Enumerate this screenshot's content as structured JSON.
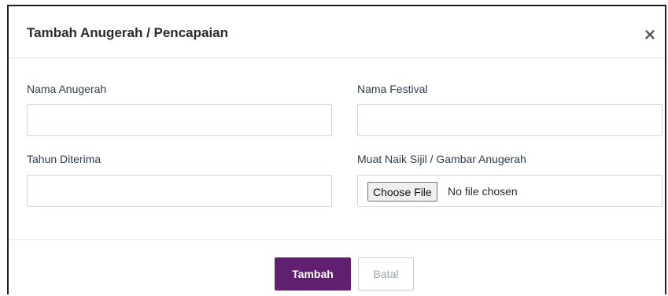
{
  "modal": {
    "title": "Tambah Anugerah / Pencapaian",
    "close_icon": "close-icon"
  },
  "form": {
    "award_name": {
      "label": "Nama Anugerah",
      "value": ""
    },
    "festival_name": {
      "label": "Nama Festival",
      "value": ""
    },
    "year_received": {
      "label": "Tahun Diterima",
      "value": ""
    },
    "certificate_upload": {
      "label": "Muat Naik Sijil / Gambar Anugerah",
      "button_label": "Choose File",
      "status_text": "No file chosen"
    }
  },
  "footer": {
    "submit_label": "Tambah",
    "cancel_label": "Batal"
  },
  "colors": {
    "primary": "#61206f",
    "border": "#ced4da",
    "label_text": "#2f3d4e"
  }
}
